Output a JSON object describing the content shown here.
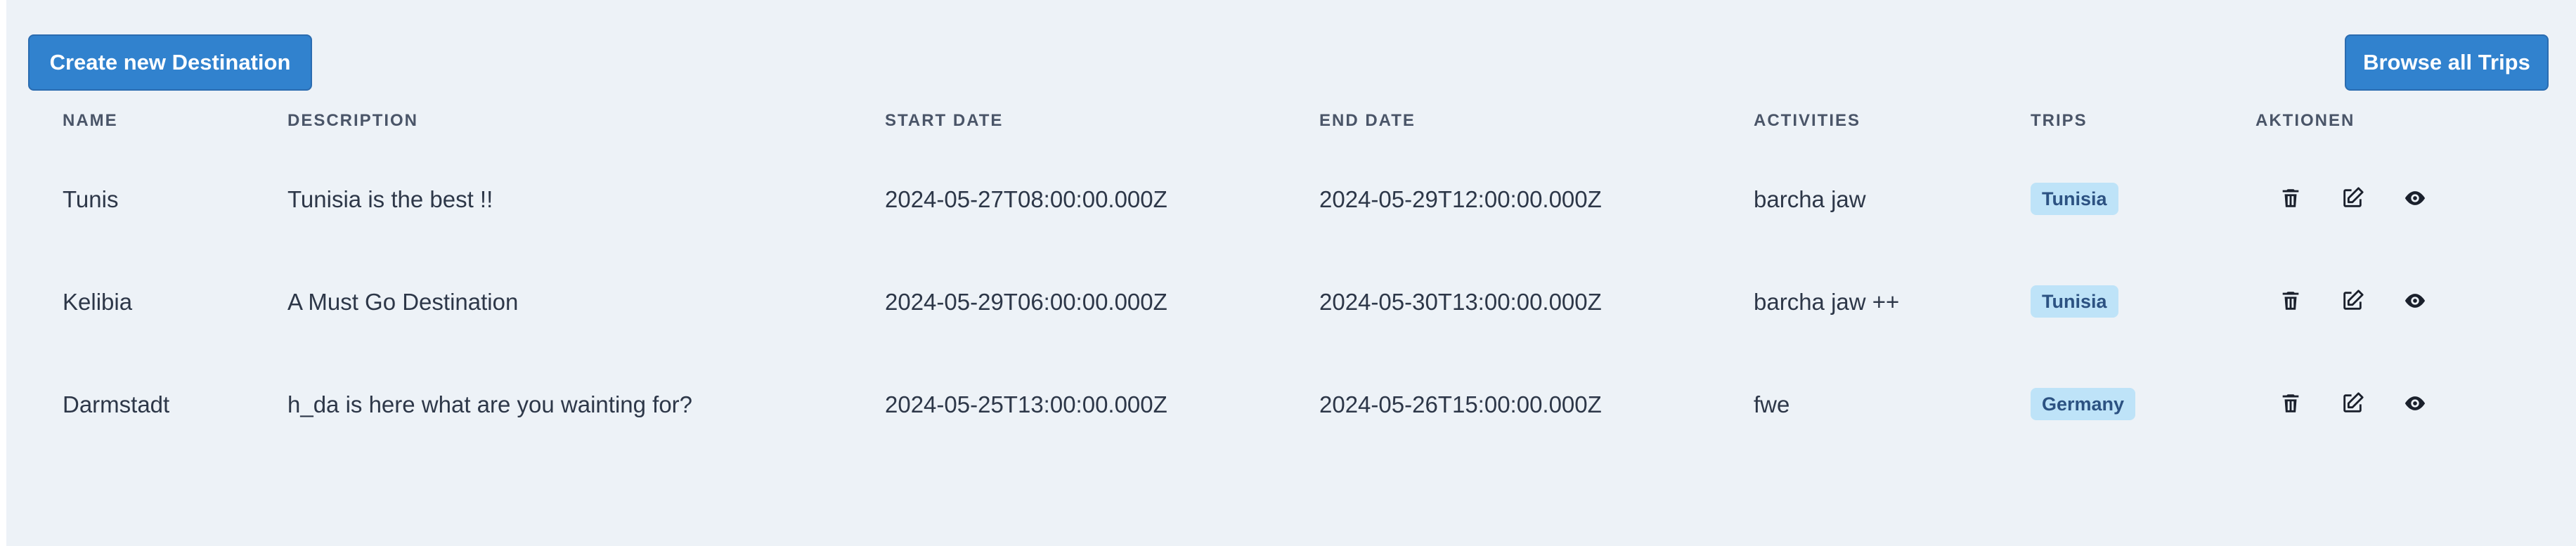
{
  "toolbar": {
    "create_label": "Create new Destination",
    "browse_label": "Browse all Trips"
  },
  "table": {
    "columns": [
      "NAME",
      "DESCRIPTION",
      "START DATE",
      "END DATE",
      "ACTIVITIES",
      "TRIPS",
      "AKTIONEN"
    ],
    "rows": [
      {
        "name": "Tunis",
        "description": "Tunisia is the best !!",
        "start_date": "2024-05-27T08:00:00.000Z",
        "end_date": "2024-05-29T12:00:00.000Z",
        "activities": "barcha jaw",
        "trip": "Tunisia"
      },
      {
        "name": "Kelibia",
        "description": "A Must Go Destination",
        "start_date": "2024-05-29T06:00:00.000Z",
        "end_date": "2024-05-30T13:00:00.000Z",
        "activities": "barcha jaw ++",
        "trip": "Tunisia"
      },
      {
        "name": "Darmstadt",
        "description": "h_da is here what are you wainting for?",
        "start_date": "2024-05-25T13:00:00.000Z",
        "end_date": "2024-05-26T15:00:00.000Z",
        "activities": "fwe",
        "trip": "Germany"
      }
    ],
    "actions": [
      "trash-icon",
      "edit-icon",
      "eye-icon"
    ]
  },
  "colors": {
    "primary": "#3182ce",
    "background": "#edf2f7",
    "badge_bg": "#bee3f8",
    "badge_text": "#2c5282"
  }
}
